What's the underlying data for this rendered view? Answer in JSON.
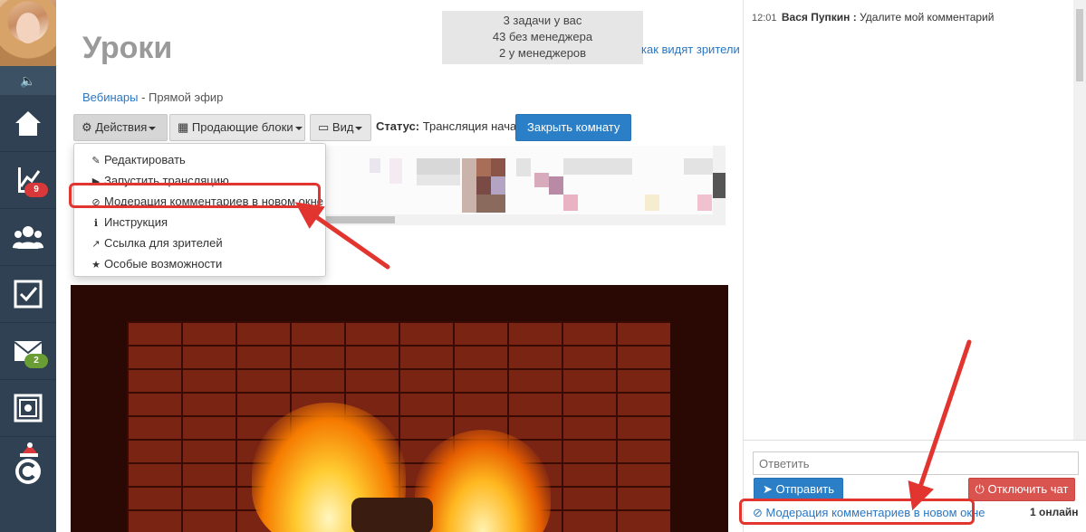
{
  "sidebar": {
    "avatar_alt": "",
    "items": [
      {
        "name": "home-icon"
      },
      {
        "name": "chart-icon",
        "badge": "9",
        "badge_color": "#d9383a"
      },
      {
        "name": "users-icon"
      },
      {
        "name": "tasks-icon"
      },
      {
        "name": "mail-icon",
        "badge": "2",
        "badge_color": "#6a9d34"
      },
      {
        "name": "safe-icon"
      },
      {
        "name": "brand-icon"
      }
    ]
  },
  "header": {
    "title": "Уроки",
    "tasks": [
      "3 задачи у вас",
      "43 без менеджера",
      "2 у менеджеров"
    ],
    "viewers_link": "как видят зрители"
  },
  "breadcrumb": {
    "parent": "Вебинары",
    "separator": "-",
    "current": "Прямой эфир"
  },
  "toolbar": {
    "actions_label": "Действия",
    "blocks_label": "Продающие блоки",
    "view_label": "Вид",
    "status_label": "Статус:",
    "status_value": "Трансляция начата",
    "close_room_label": "Закрыть комнату"
  },
  "actions_menu": {
    "items": [
      {
        "icon": "pencil-icon",
        "glyph": "✎",
        "label": "Редактировать"
      },
      {
        "icon": "youtube-icon",
        "glyph": "▶",
        "label": "Запустить трансляцию"
      },
      {
        "icon": "ban-icon",
        "glyph": "⊘",
        "label": "Модерация комментариев в новом окне"
      },
      {
        "icon": "info-icon",
        "glyph": "ℹ",
        "label": "Инструкция"
      },
      {
        "icon": "external-link-icon",
        "glyph": "↗",
        "label": "Ссылка для зрителей"
      },
      {
        "icon": "star-icon",
        "glyph": "★",
        "label": "Особые возможности"
      }
    ]
  },
  "chat": {
    "messages": [
      {
        "time": "12:01",
        "author": "Вася Пупкин :",
        "text": "Удалите мой комментарий"
      }
    ],
    "reply_placeholder": "Ответить",
    "send_label": "Отправить",
    "disable_label": "Отключить чат",
    "moderation_link": "Модерация комментариев в новом окне",
    "online": "1 онлайн"
  },
  "colors": {
    "sidebar": "#2f4152",
    "primary": "#2a7fc6",
    "danger": "#d9534f",
    "highlight": "#e3352f",
    "link": "#2a77c4"
  }
}
